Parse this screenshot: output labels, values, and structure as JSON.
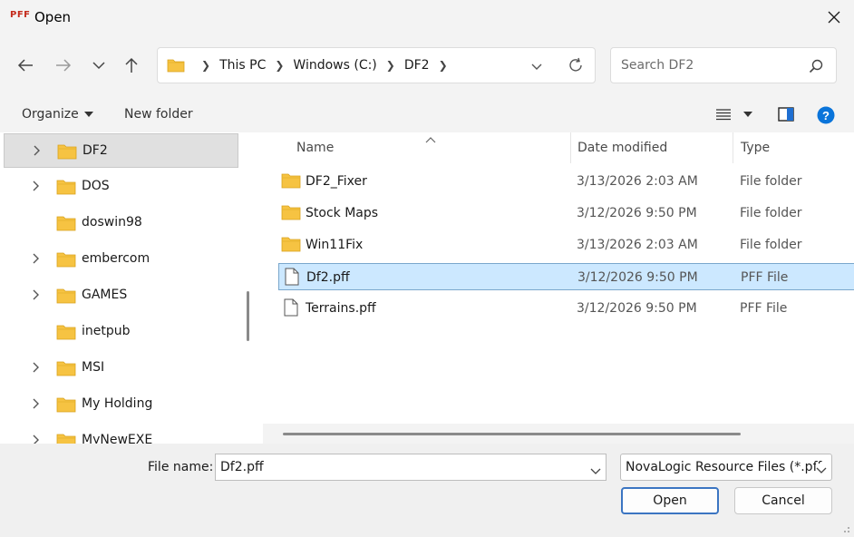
{
  "window": {
    "app_icon_text": "PFF",
    "title": "Open"
  },
  "address": {
    "crumbs": [
      "This PC",
      "Windows (C:)",
      "DF2"
    ]
  },
  "search": {
    "placeholder": "Search DF2"
  },
  "toolbar": {
    "organize_label": "Organize",
    "new_folder_label": "New folder"
  },
  "sidebar": {
    "items": [
      {
        "label": "DF2",
        "has_chevron": true,
        "selected": true
      },
      {
        "label": "DOS",
        "has_chevron": true
      },
      {
        "label": "doswin98",
        "has_chevron": false
      },
      {
        "label": "embercom",
        "has_chevron": true
      },
      {
        "label": "GAMES",
        "has_chevron": true
      },
      {
        "label": "inetpub",
        "has_chevron": false
      },
      {
        "label": "MSI",
        "has_chevron": true
      },
      {
        "label": "My Holding",
        "has_chevron": true
      },
      {
        "label": "MyNewEXE",
        "has_chevron": true
      }
    ]
  },
  "columns": {
    "name": "Name",
    "date": "Date modified",
    "type": "Type"
  },
  "files": [
    {
      "name": "DF2_Fixer",
      "date": "3/13/2026 2:03 AM",
      "type": "File folder",
      "kind": "folder"
    },
    {
      "name": "Stock Maps",
      "date": "3/12/2026 9:50 PM",
      "type": "File folder",
      "kind": "folder"
    },
    {
      "name": "Win11Fix",
      "date": "3/13/2026 2:03 AM",
      "type": "File folder",
      "kind": "folder"
    },
    {
      "name": "Df2.pff",
      "date": "3/12/2026 9:50 PM",
      "type": "PFF File",
      "kind": "file",
      "selected": true
    },
    {
      "name": "Terrains.pff",
      "date": "3/12/2026 9:50 PM",
      "type": "PFF File",
      "kind": "file"
    }
  ],
  "footer": {
    "file_name_label": "File name:",
    "file_name_value": "Df2.pff",
    "file_type_value": "NovaLogic Resource Files (*.pff",
    "open_label": "Open",
    "cancel_label": "Cancel"
  },
  "colors": {
    "accent": "#0067c0",
    "selection": "#cce8ff",
    "folder": "#f6c342"
  }
}
